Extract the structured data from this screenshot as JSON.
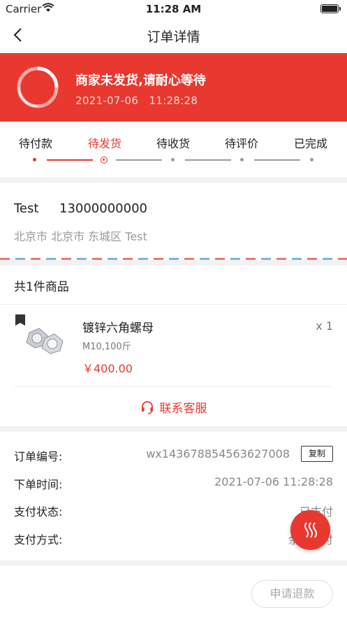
{
  "status_bar": {
    "carrier": "Carrier",
    "time": "11:28 AM"
  },
  "nav": {
    "title": "订单详情"
  },
  "banner": {
    "title": "商家未发货,请耐心等待",
    "time": "2021-07-06　11:28:28"
  },
  "steps": [
    {
      "label": "待付款"
    },
    {
      "label": "待发货"
    },
    {
      "label": "待收货"
    },
    {
      "label": "待评价"
    },
    {
      "label": "已完成"
    }
  ],
  "current_step": 2,
  "address": {
    "name": "Test",
    "phone": "13000000000",
    "detail": "北京市 北京市 东城区 Test"
  },
  "goods": {
    "count_label": "共1件商品",
    "items": [
      {
        "name": "镀锌六角螺母",
        "spec": "M10,100斤",
        "price": "￥400.00",
        "qty": "x 1"
      }
    ],
    "service_label": "联系客服"
  },
  "order_info": {
    "order_no_label": "订单编号:",
    "order_no": "wx143678854563627008",
    "copy_label": "复制",
    "time_label": "下单时间:",
    "time": "2021-07-06 11:28:28",
    "pay_status_label": "支付状态:",
    "pay_status": "已支付",
    "pay_method_label": "支付方式:",
    "pay_method": "余额支付"
  },
  "bottom": {
    "refund_label": "申请退款"
  },
  "colors": {
    "accent": "#e8382f",
    "muted": "#999999"
  },
  "icons": [
    "wifi-icon",
    "battery-icon",
    "back-icon",
    "loading-ring-icon",
    "headset-icon",
    "heat-waves-icon"
  ]
}
